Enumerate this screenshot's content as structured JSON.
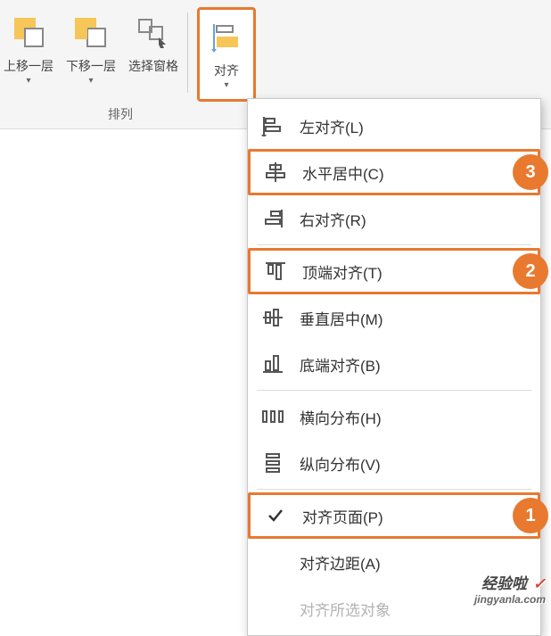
{
  "ribbon": {
    "group_label": "排列",
    "buttons": {
      "bring_forward": "上移一层",
      "send_backward": "下移一层",
      "selection_pane": "选择窗格",
      "align": "对齐"
    }
  },
  "menu": {
    "align_left": "左对齐(L)",
    "align_center_h": "水平居中(C)",
    "align_right": "右对齐(R)",
    "align_top": "顶端对齐(T)",
    "align_middle_v": "垂直居中(M)",
    "align_bottom": "底端对齐(B)",
    "distribute_h": "横向分布(H)",
    "distribute_v": "纵向分布(V)",
    "align_page": "对齐页面(P)",
    "align_margin": "对齐边距(A)",
    "align_selected": "对齐所选对象"
  },
  "markers": {
    "m1": "1",
    "m2": "2",
    "m3": "3"
  },
  "watermark": {
    "text": "经验啦",
    "check": "✓",
    "url": "jingyanla.com"
  }
}
